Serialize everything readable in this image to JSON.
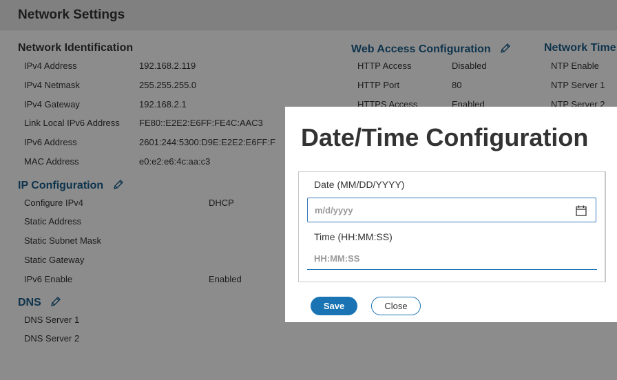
{
  "page": {
    "title": "Network Settings"
  },
  "network_identification": {
    "heading": "Network Identification",
    "rows": [
      {
        "label": "IPv4 Address",
        "value": "192.168.2.119"
      },
      {
        "label": "IPv4 Netmask",
        "value": "255.255.255.0"
      },
      {
        "label": "IPv4 Gateway",
        "value": "192.168.2.1"
      },
      {
        "label": "Link Local IPv6 Address",
        "value": "FE80::E2E2:E6FF:FE4C:AAC3"
      },
      {
        "label": "IPv6 Address",
        "value": "2601:244:5300:D9E:E2E2:E6FF:F"
      },
      {
        "label": "MAC Address",
        "value": "e0:e2:e6:4c:aa:c3"
      }
    ]
  },
  "ip_configuration": {
    "heading": "IP Configuration",
    "rows": [
      {
        "label": "Configure IPv4",
        "value": "DHCP"
      },
      {
        "label": "Static Address",
        "value": ""
      },
      {
        "label": "Static Subnet Mask",
        "value": ""
      },
      {
        "label": "Static Gateway",
        "value": ""
      },
      {
        "label": "IPv6 Enable",
        "value": "Enabled"
      }
    ]
  },
  "dns": {
    "heading": "DNS",
    "rows": [
      {
        "label": "DNS Server 1"
      },
      {
        "label": "DNS Server 2"
      }
    ]
  },
  "web_access": {
    "heading": "Web Access Configuration",
    "rows": [
      {
        "label": "HTTP Access",
        "value": "Disabled"
      },
      {
        "label": "HTTP Port",
        "value": "80"
      },
      {
        "label": "HTTPS Access",
        "value": "Enabled"
      }
    ]
  },
  "network_time": {
    "heading": "Network Time",
    "rows": [
      {
        "label": "NTP Enable"
      },
      {
        "label": "NTP Server 1"
      },
      {
        "label": "NTP Server 2"
      }
    ]
  },
  "modal": {
    "title": "Date/Time Configuration",
    "date_label": "Date (MM/DD/YYYY)",
    "date_placeholder": "m/d/yyyy",
    "time_label": "Time (HH:MM:SS)",
    "time_placeholder": "HH:MM:SS",
    "save_label": "Save",
    "close_label": "Close"
  },
  "icons": {
    "edit": "pencil-icon",
    "calendar": "calendar-icon"
  },
  "colors": {
    "accent": "#1a74b3",
    "heading_blue": "#1a5e8a",
    "overlay": "rgba(0,0,0,0.45)"
  }
}
